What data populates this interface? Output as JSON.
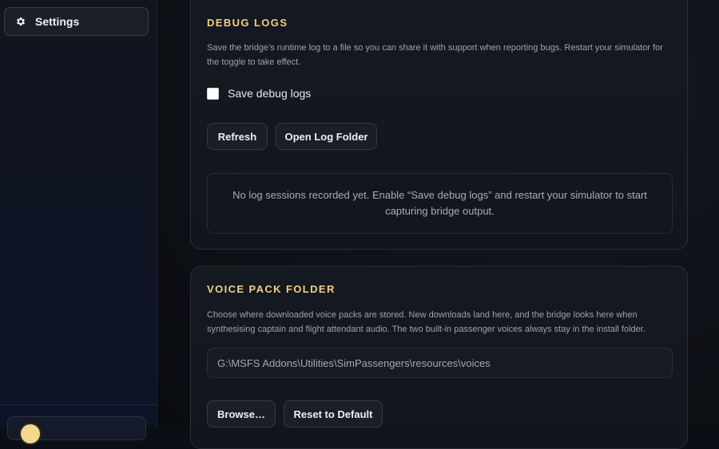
{
  "sidebar": {
    "items": [
      {
        "label": "Settings",
        "icon": "gear-icon",
        "active": true
      }
    ]
  },
  "debug_logs": {
    "title": "DEBUG LOGS",
    "description": "Save the bridge’s runtime log to a file so you can share it with support when reporting bugs. Restart your simulator for the toggle to take effect.",
    "checkbox_label": "Save debug logs",
    "checkbox_checked": false,
    "refresh_label": "Refresh",
    "open_folder_label": "Open Log Folder",
    "empty_message": "No log sessions recorded yet. Enable “Save debug logs” and restart your simulator to start capturing bridge output."
  },
  "voice_pack": {
    "title": "VOICE PACK FOLDER",
    "description": "Choose where downloaded voice packs are stored. New downloads land here, and the bridge looks here when synthesising captain and flight attendant audio. The two built-in passenger voices always stay in the install folder.",
    "path_value": "G:\\MSFS Addons\\Utilities\\SimPassengers\\resources\\voices",
    "browse_label": "Browse…",
    "reset_label": "Reset to Default"
  },
  "colors": {
    "accent_title": "#f1cf86",
    "background": "#0b0e14"
  }
}
